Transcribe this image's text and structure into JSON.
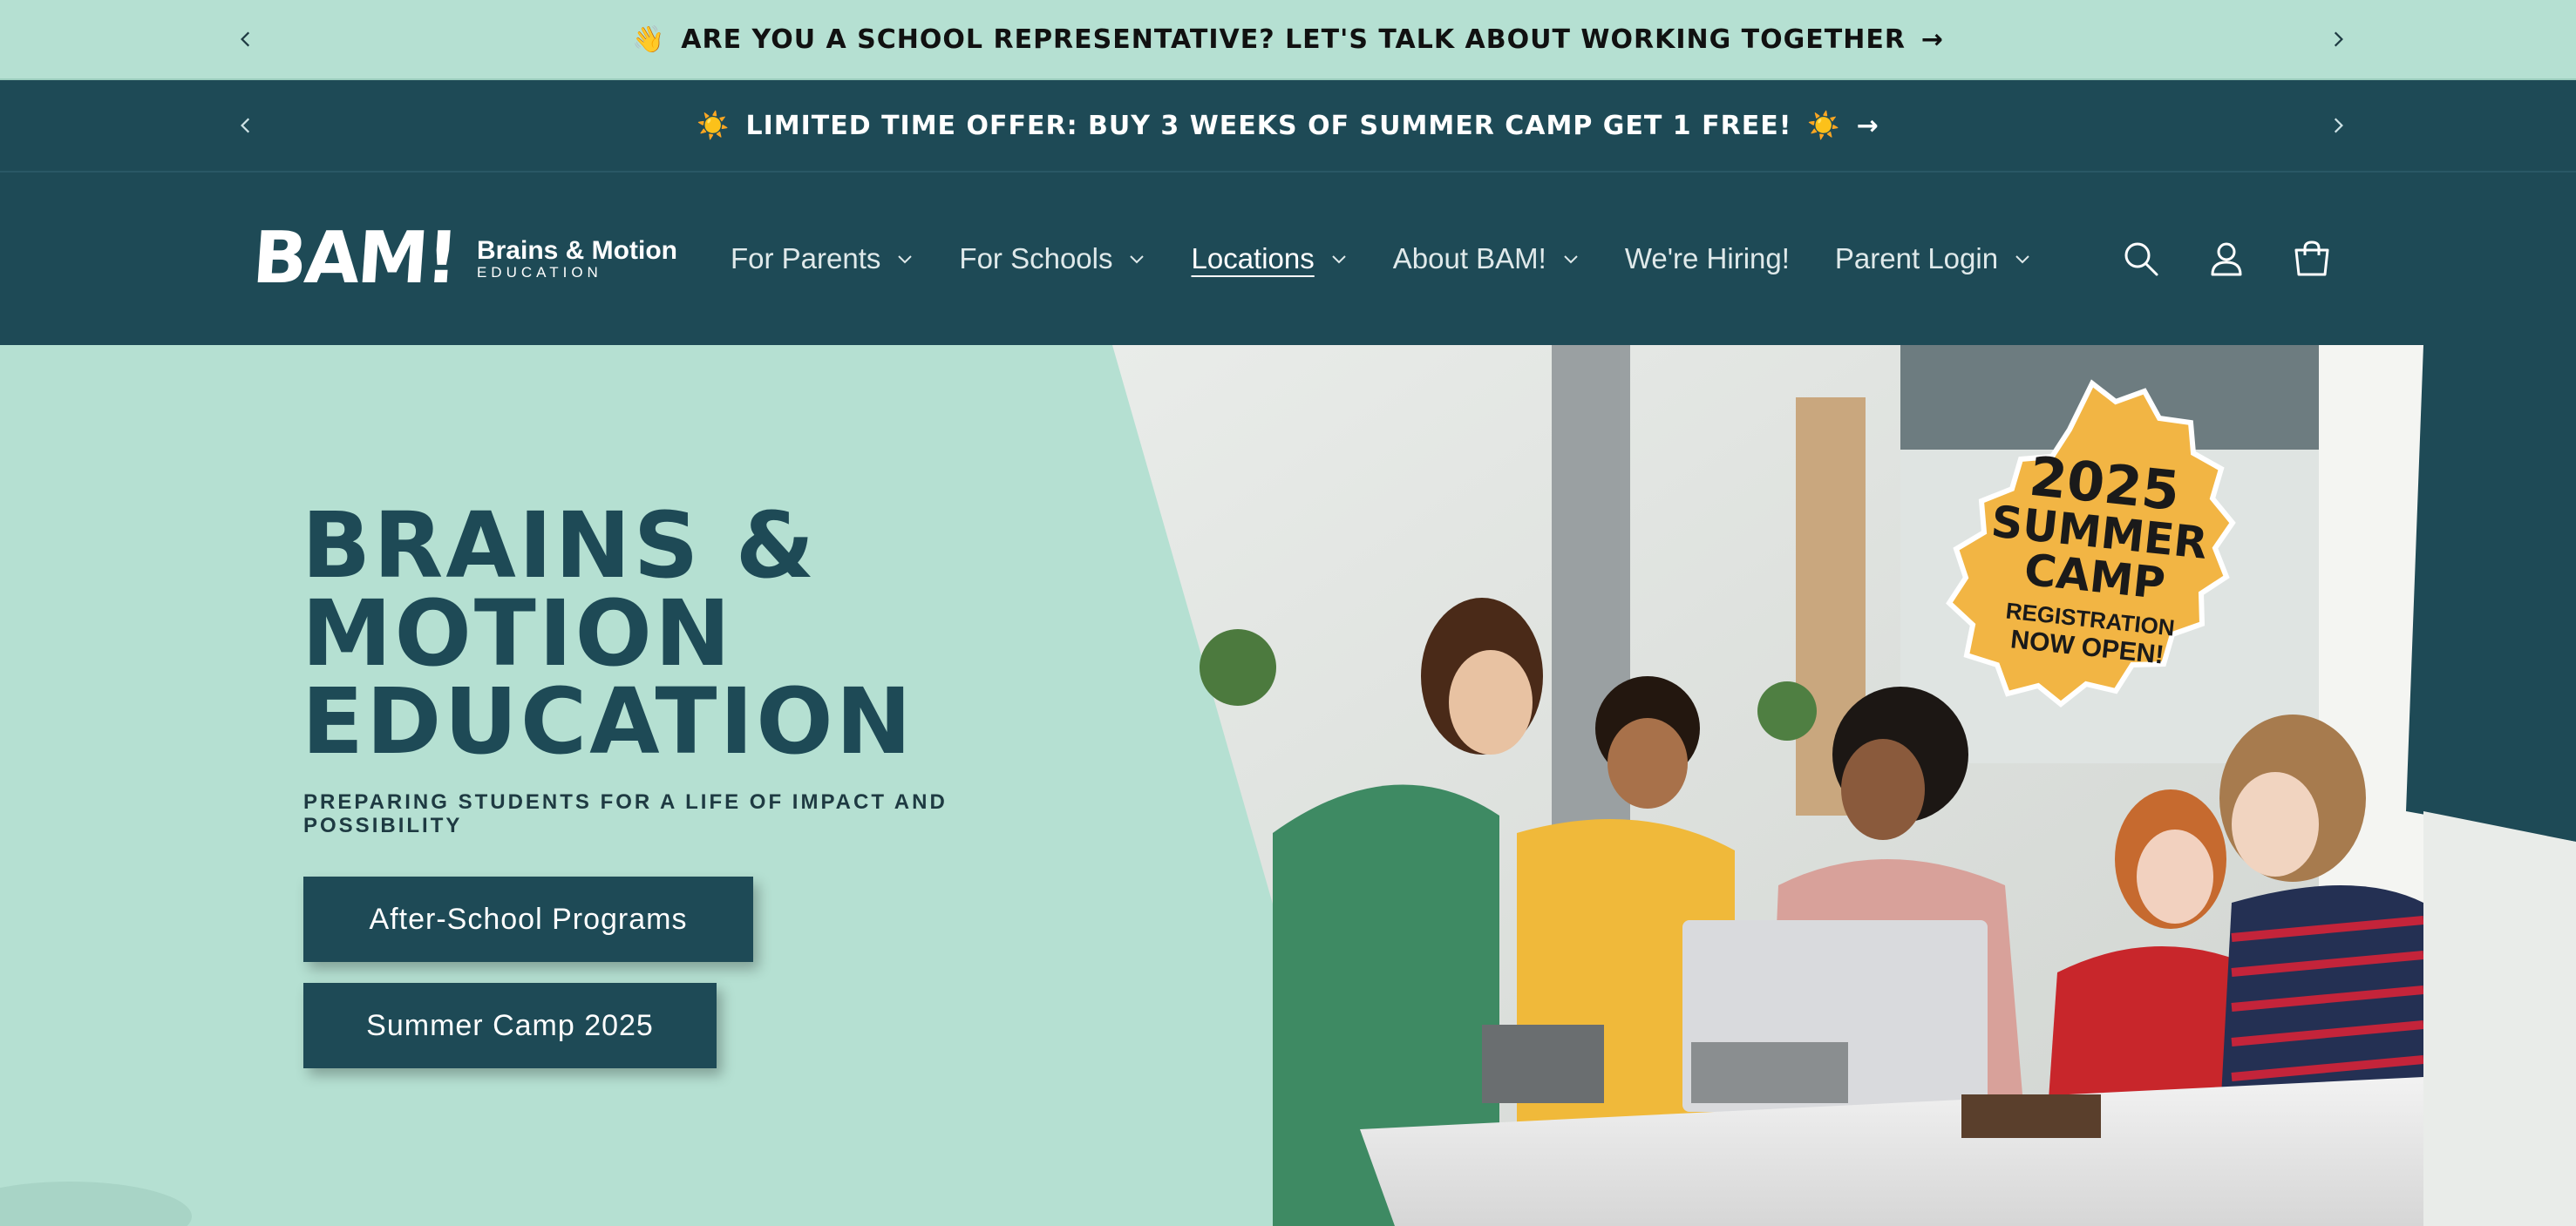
{
  "announcements": [
    {
      "emoji": "👋",
      "text": "ARE YOU A SCHOOL REPRESENTATIVE? LET'S TALK ABOUT WORKING TOGETHER",
      "arrow": "→"
    },
    {
      "emoji_left": "☀️",
      "text": "LIMITED TIME OFFER: BUY 3 WEEKS OF SUMMER CAMP GET 1 FREE!",
      "emoji_right": "☀️",
      "arrow": "→"
    }
  ],
  "header": {
    "logo_mark": "BAM!",
    "logo_name": "Brains & Motion",
    "logo_sub": "EDUCATION",
    "nav": [
      {
        "label": "For Parents",
        "dropdown": true
      },
      {
        "label": "For Schools",
        "dropdown": true
      },
      {
        "label": "Locations",
        "dropdown": true,
        "active": true
      },
      {
        "label": "About BAM!",
        "dropdown": true
      },
      {
        "label": "We're Hiring!",
        "dropdown": false
      },
      {
        "label": "Parent Login",
        "dropdown": true
      }
    ],
    "icons": [
      "search-icon",
      "account-icon",
      "cart-icon"
    ]
  },
  "hero": {
    "title_lines": [
      "BRAINS &",
      "MOTION",
      "EDUCATION"
    ],
    "tagline": "PREPARING STUDENTS FOR A LIFE OF IMPACT AND POSSIBILITY",
    "buttons": [
      "After-School Programs",
      "Summer Camp 2025"
    ],
    "badge": {
      "year": "2025",
      "line1": "SUMMER",
      "line2": "CAMP",
      "line3": "REGISTRATION",
      "line4": "NOW OPEN!"
    }
  },
  "colors": {
    "mint": "#b5e0d2",
    "teal_dark": "#1e4a56",
    "badge_gold": "#f2b544"
  }
}
